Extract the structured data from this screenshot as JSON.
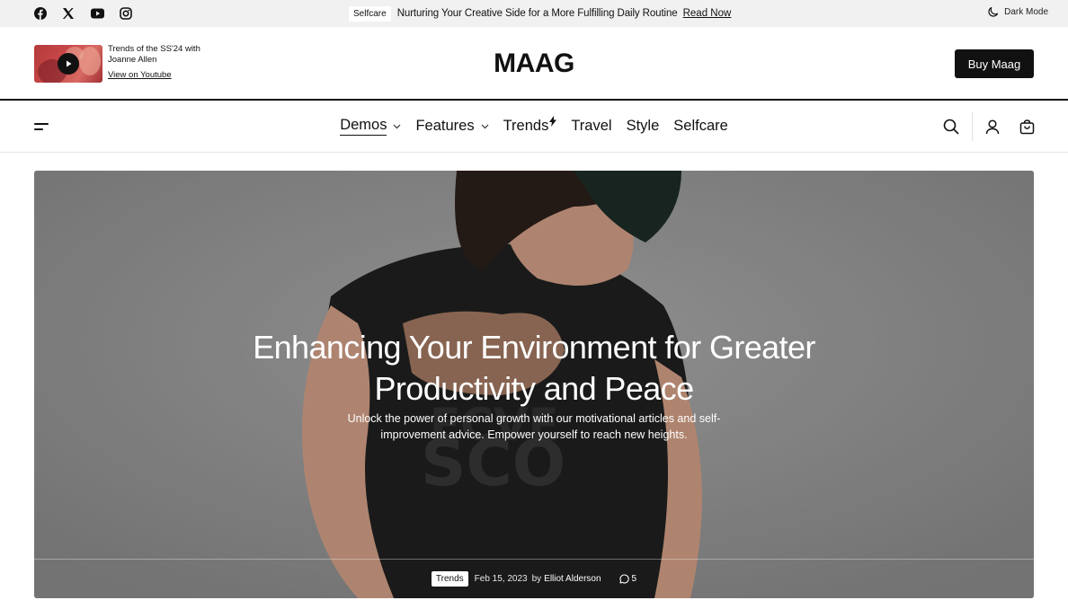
{
  "topbar": {
    "social": [
      {
        "name": "facebook-icon"
      },
      {
        "name": "x-icon"
      },
      {
        "name": "youtube-icon"
      },
      {
        "name": "instagram-icon"
      }
    ],
    "ticker": {
      "badge": "Selfcare",
      "text": "Nurturing Your Creative Side for a More Fulfilling Daily Routine",
      "link": "Read Now"
    },
    "dark_mode": {
      "label": "Dark Mode",
      "icon": "moon-icon"
    }
  },
  "header": {
    "video": {
      "title": "Trends of the SS'24 with Joanne Allen",
      "link": "View on Youtube",
      "icon": "play-icon"
    },
    "logo": "MAAG",
    "buy_button": "Buy Maag"
  },
  "nav": {
    "items": [
      {
        "label": "Demos",
        "has_dropdown": true,
        "active": true
      },
      {
        "label": "Features",
        "has_dropdown": true
      },
      {
        "label": "Trends",
        "badge_icon": "bolt-icon"
      },
      {
        "label": "Travel"
      },
      {
        "label": "Style"
      },
      {
        "label": "Selfcare"
      }
    ],
    "icons": [
      "menu-icon",
      "search-icon",
      "user-icon",
      "cart-icon"
    ]
  },
  "hero": {
    "title": "Enhancing Your Environment for Greater Productivity and Peace",
    "subtitle": "Unlock the power of personal growth with our motivational articles and self-improvement advice. Empower yourself to reach new heights.",
    "category": "Trends",
    "date": "Feb 15, 2023",
    "by": "by",
    "author": "Elliot Alderson",
    "comments": "5"
  },
  "colors": {
    "accent": "#111111",
    "topbar_bg": "#f1f1f1",
    "hero_bg": "#8e8e8e"
  }
}
